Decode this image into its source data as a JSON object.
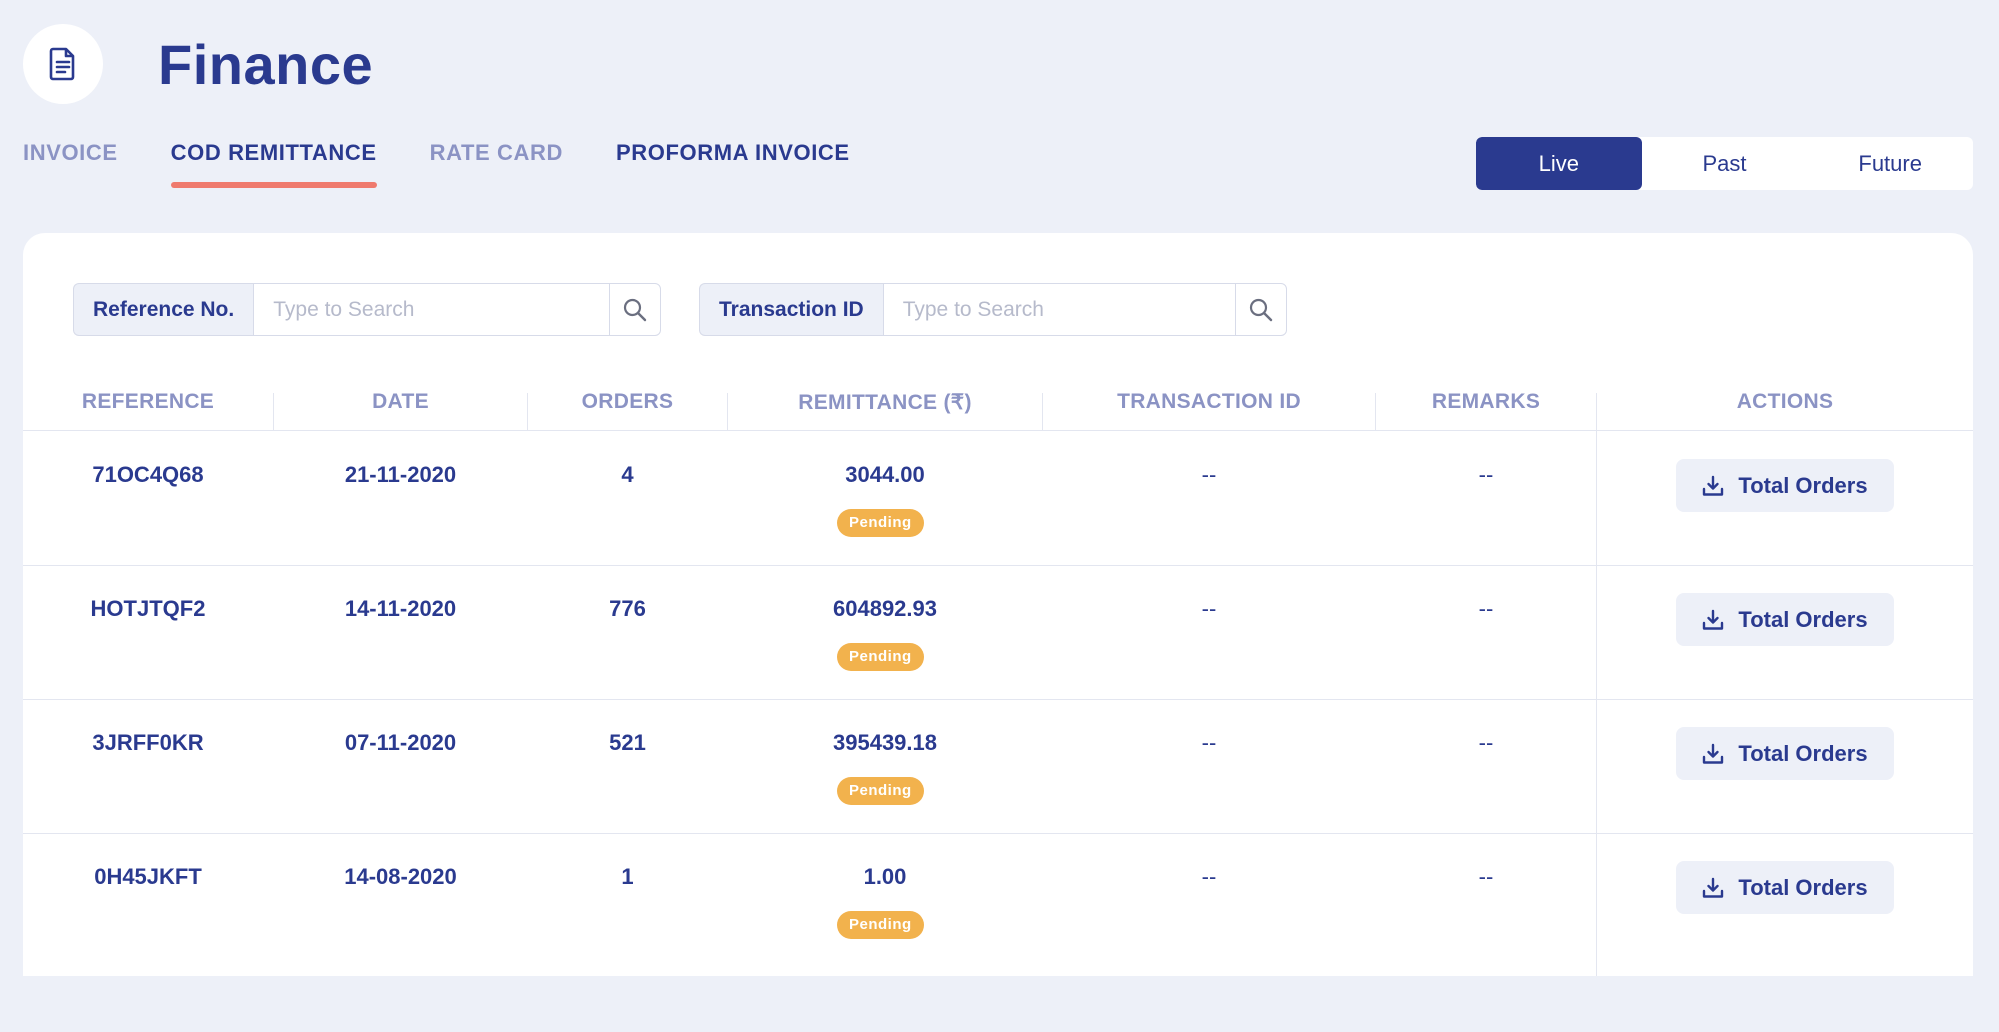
{
  "header": {
    "title": "Finance",
    "icon": "document-icon"
  },
  "tabs": [
    {
      "label": "INVOICE",
      "active": false
    },
    {
      "label": "COD REMITTANCE",
      "active": true
    },
    {
      "label": "RATE CARD",
      "active": false
    },
    {
      "label": "PROFORMA INVOICE",
      "active": false
    }
  ],
  "period_toggle": {
    "options": [
      "Live",
      "Past",
      "Future"
    ],
    "selected": "Live"
  },
  "filters": {
    "reference": {
      "label": "Reference No.",
      "placeholder": "Type to Search",
      "value": ""
    },
    "transaction": {
      "label": "Transaction ID",
      "placeholder": "Type to Search",
      "value": ""
    }
  },
  "table": {
    "columns": [
      "REFERENCE",
      "DATE",
      "ORDERS",
      "REMITTANCE (₹)",
      "TRANSACTION ID",
      "REMARKS",
      "ACTIONS"
    ],
    "rows": [
      {
        "reference": "71OC4Q68",
        "date": "21-11-2020",
        "orders": "4",
        "remittance": "3044.00",
        "status": "Pending",
        "transaction_id": "--",
        "remarks": "--",
        "action": "Total Orders"
      },
      {
        "reference": "HOTJTQF2",
        "date": "14-11-2020",
        "orders": "776",
        "remittance": "604892.93",
        "status": "Pending",
        "transaction_id": "--",
        "remarks": "--",
        "action": "Total Orders"
      },
      {
        "reference": "3JRFF0KR",
        "date": "07-11-2020",
        "orders": "521",
        "remittance": "395439.18",
        "status": "Pending",
        "transaction_id": "--",
        "remarks": "--",
        "action": "Total Orders"
      },
      {
        "reference": "0H45JKFT",
        "date": "14-08-2020",
        "orders": "1",
        "remittance": "1.00",
        "status": "Pending",
        "transaction_id": "--",
        "remarks": "--",
        "action": "Total Orders"
      }
    ]
  },
  "colors": {
    "primary": "#2a3a8f",
    "muted": "#8b93c4",
    "accent_underline": "#ef7a6e",
    "pending_badge": "#f2b24d",
    "background": "#edf0f8"
  }
}
